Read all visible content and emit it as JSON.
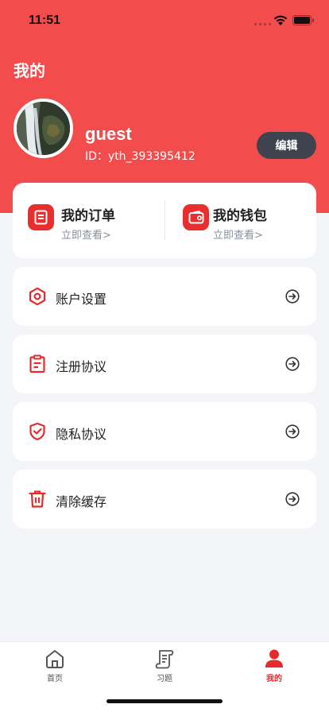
{
  "status": {
    "time": "11:51"
  },
  "header": {
    "title": "我的"
  },
  "profile": {
    "username": "guest",
    "user_id": "ID：yth_393395412",
    "edit_label": "编辑"
  },
  "quick": [
    {
      "title": "我的订单",
      "subtitle": "立即查看>",
      "icon": "order-icon"
    },
    {
      "title": "我的钱包",
      "subtitle": "立即查看>",
      "icon": "wallet-icon"
    }
  ],
  "menu": [
    {
      "label": "账户设置",
      "icon": "settings-icon"
    },
    {
      "label": "注册协议",
      "icon": "clipboard-icon"
    },
    {
      "label": "隐私协议",
      "icon": "shield-check-icon"
    },
    {
      "label": "清除缓存",
      "icon": "trash-icon"
    }
  ],
  "tabs": [
    {
      "label": "首页",
      "icon": "home-icon",
      "active": false
    },
    {
      "label": "习题",
      "icon": "scroll-icon",
      "active": false
    },
    {
      "label": "我的",
      "icon": "user-icon",
      "active": true
    }
  ],
  "colors": {
    "brand": "#f24c4c",
    "accent": "#e52b2b",
    "edit_button": "#3e434e",
    "background": "#f4f5f8"
  }
}
